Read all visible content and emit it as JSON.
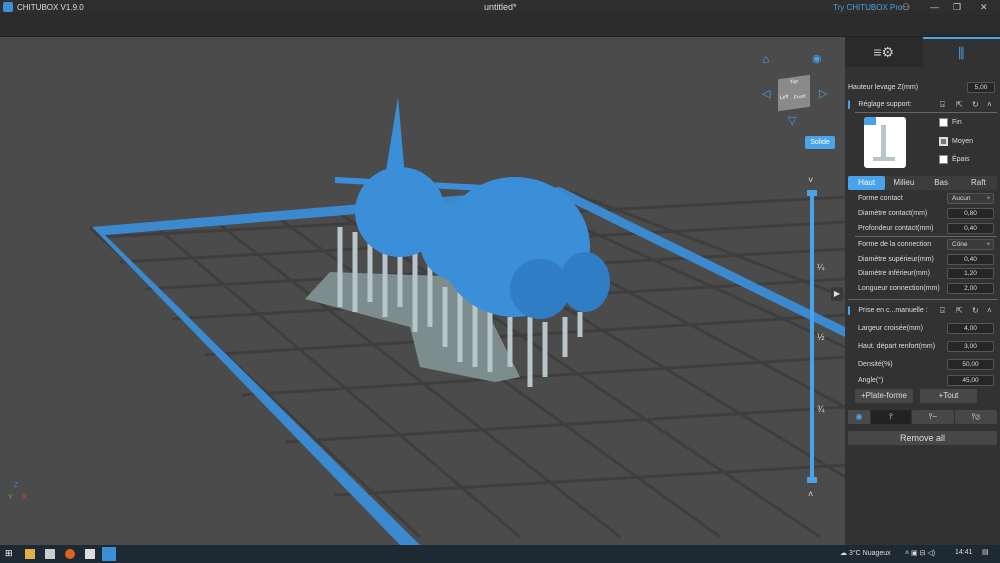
{
  "titlebar": {
    "app": "CHITUBOX V1.9.0",
    "document": "untitled*",
    "pro_link": "Try CHITUBOX Pro"
  },
  "viewport": {
    "view_mode": "Solide",
    "cube_faces": {
      "front": "Front",
      "left": "Left",
      "top": "Top"
    },
    "slider_ticks": [
      "¼",
      "½",
      "¾"
    ],
    "axes": [
      "X",
      "Y",
      "Z"
    ]
  },
  "panel": {
    "lift_height": {
      "label": "Hauteur levage Z(mm)",
      "value": "5,00"
    },
    "support_settings": {
      "title": "Réglage support:",
      "options": [
        {
          "label": "Fin",
          "checked": false
        },
        {
          "label": "Moyen",
          "checked": true
        },
        {
          "label": "Épais",
          "checked": false
        }
      ]
    },
    "tabs": [
      {
        "label": "Haut",
        "active": true
      },
      {
        "label": "Milieu"
      },
      {
        "label": "Bas"
      },
      {
        "label": "Raft"
      }
    ],
    "fields": [
      {
        "label": "Forme contact",
        "value": "Aucun",
        "type": "select"
      },
      {
        "label": "Diamètre contact(mm)",
        "value": "0,80"
      },
      {
        "label": "Profondeur contact(mm)",
        "value": "0,40"
      },
      {
        "label": "Forme de la connection",
        "value": "Cône",
        "type": "select"
      },
      {
        "label": "Diamètre supérieur(mm)",
        "value": "0,40"
      },
      {
        "label": "Diamètre inférieur(mm)",
        "value": "1,20"
      },
      {
        "label": "Longueur connection(mm)",
        "value": "2,00"
      }
    ],
    "manual": {
      "title": "Prise en c...manuelle :",
      "fields": [
        {
          "label": "Largeur croisée(mm)",
          "value": "4,00"
        },
        {
          "label": "Haut. départ renfort(mm)",
          "value": "3,00"
        },
        {
          "label": "Densité(%)",
          "value": "50,00"
        },
        {
          "label": "Angle(°)",
          "value": "45,00"
        }
      ]
    },
    "add_platform": "+Plate-forme",
    "add_all": "+Tout",
    "remove_all": "Remove all"
  },
  "taskbar": {
    "weather": "3°C  Nuageux",
    "time": "14:41"
  },
  "colors": {
    "accent": "#4aa3e8",
    "model": "#3b8fd9",
    "support": "#b7c6c8"
  }
}
